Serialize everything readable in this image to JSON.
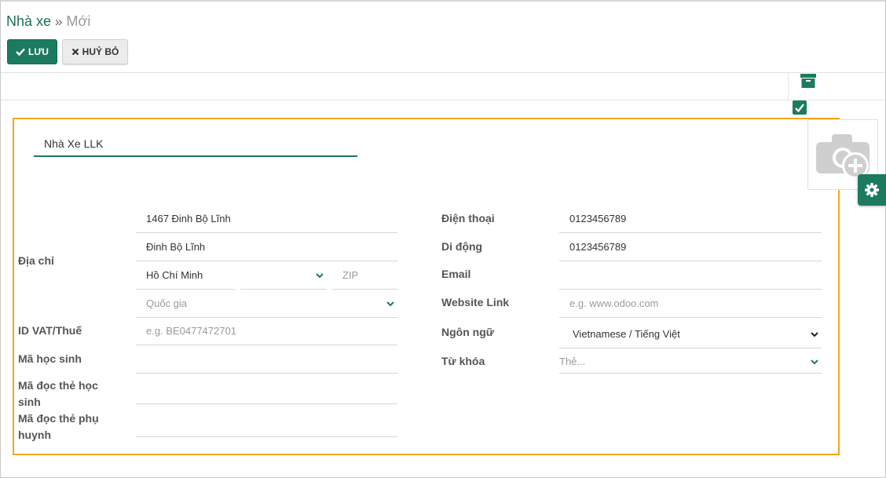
{
  "breadcrumb": {
    "parent": "Nhà xe",
    "separator": "»",
    "current": "Mới"
  },
  "toolbar": {
    "save_label": "LƯU",
    "discard_label": "HUỶ BỎ"
  },
  "icons": {
    "save": "check-icon",
    "discard": "x-icon",
    "archive": "archive-box-icon",
    "active": "checkbox-checked-icon",
    "photo": "camera-plus-icon",
    "settings": "gear-icon",
    "dropdown": "chevron-down-icon"
  },
  "colors": {
    "accent": "#1c7b5f",
    "highlight_border": "#f2a71d"
  },
  "form": {
    "name_value": "Nhà Xe LLK",
    "address": {
      "label": "Địa chỉ",
      "street": "1467 Đinh Bộ Lĩnh",
      "street2": "Đinh Bộ Lĩnh",
      "city": "Hồ Chí Minh",
      "state": "",
      "zip_placeholder": "ZIP",
      "country_placeholder": "Quốc gia"
    },
    "vat": {
      "label": "ID VAT/Thuế",
      "placeholder": "e.g. BE0477472701"
    },
    "student_code": {
      "label": "Mã học sinh",
      "value": ""
    },
    "student_card": {
      "label": "Mã đọc thẻ học sinh",
      "value": ""
    },
    "parent_card": {
      "label": "Mã đọc thẻ phụ huynh",
      "value": ""
    },
    "phone": {
      "label": "Điện thoại",
      "value": "0123456789"
    },
    "mobile": {
      "label": "Di động",
      "value": "0123456789"
    },
    "email": {
      "label": "Email",
      "value": ""
    },
    "website": {
      "label": "Website Link",
      "placeholder": "e.g. www.odoo.com"
    },
    "language": {
      "label": "Ngôn ngữ",
      "value": "Vietnamese / Tiếng Việt"
    },
    "tags": {
      "label": "Từ khóa",
      "placeholder": "Thẻ..."
    }
  }
}
